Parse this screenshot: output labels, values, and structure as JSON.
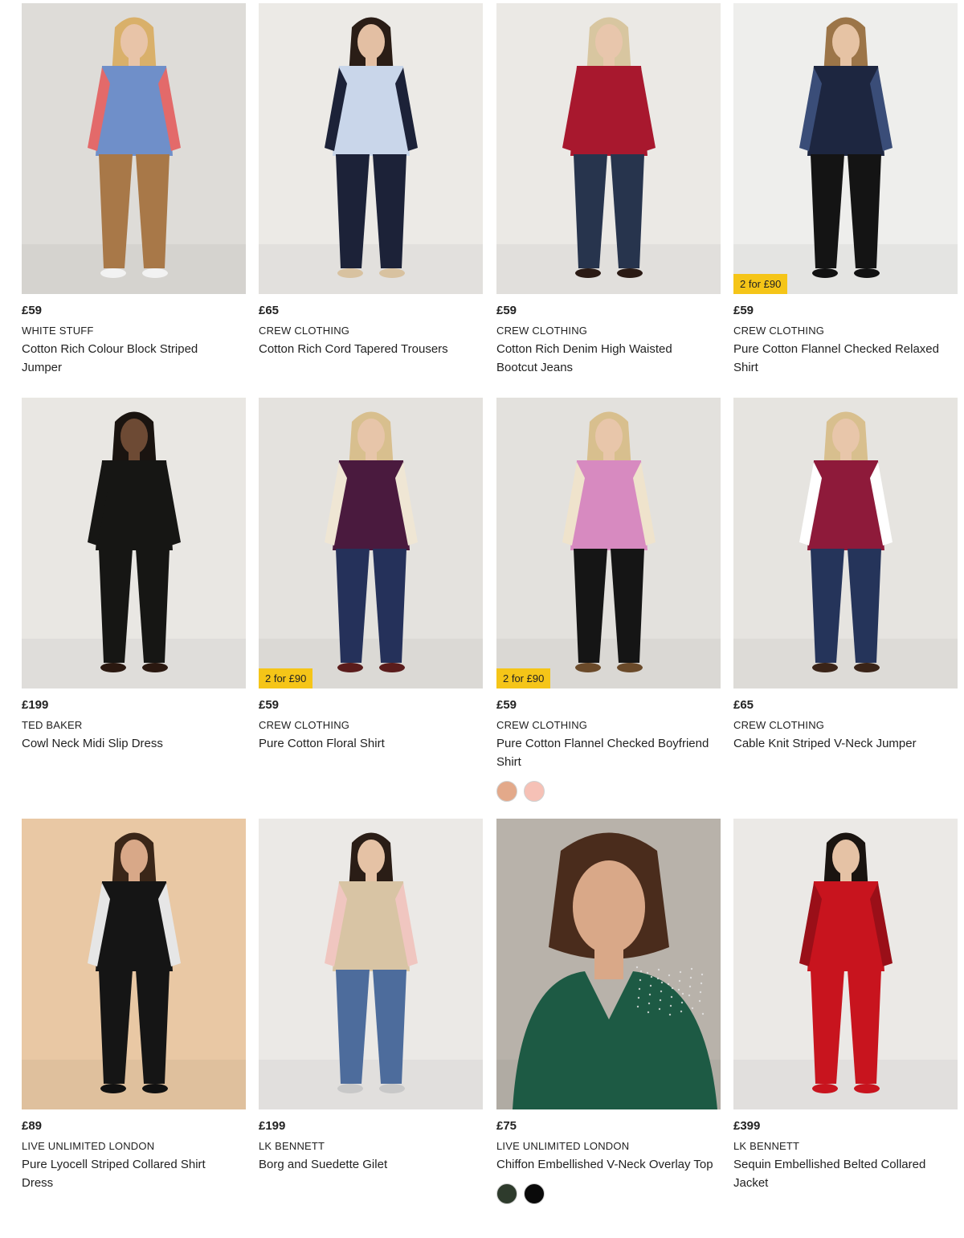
{
  "products": [
    {
      "price": "£59",
      "brand": "WHITE STUFF",
      "title": "Cotton Rich Colour Block Striped Jumper",
      "promo": "",
      "swatches": []
    },
    {
      "price": "£65",
      "brand": "CREW CLOTHING",
      "title": "Cotton Rich Cord Tapered Trousers",
      "promo": "",
      "swatches": []
    },
    {
      "price": "£59",
      "brand": "CREW CLOTHING",
      "title": "Cotton Rich Denim High Waisted Bootcut Jeans",
      "promo": "",
      "swatches": []
    },
    {
      "price": "£59",
      "brand": "CREW CLOTHING",
      "title": "Pure Cotton Flannel Checked Relaxed Shirt",
      "promo": "2 for £90",
      "swatches": []
    },
    {
      "price": "£199",
      "brand": "TED BAKER",
      "title": "Cowl Neck Midi Slip Dress",
      "promo": "",
      "swatches": []
    },
    {
      "price": "£59",
      "brand": "CREW CLOTHING",
      "title": "Pure Cotton Floral Shirt",
      "promo": "2 for £90",
      "swatches": []
    },
    {
      "price": "£59",
      "brand": "CREW CLOTHING",
      "title": "Pure Cotton Flannel Checked Boyfriend Shirt",
      "promo": "2 for £90",
      "swatches": [
        "#e3a98a",
        "#f6c1b6"
      ]
    },
    {
      "price": "£65",
      "brand": "CREW CLOTHING",
      "title": "Cable Knit Striped V-Neck Jumper",
      "promo": "",
      "swatches": []
    },
    {
      "price": "£89",
      "brand": "LIVE UNLIMITED LONDON",
      "title": "Pure Lyocell Striped Collared Shirt Dress",
      "promo": "",
      "swatches": []
    },
    {
      "price": "£199",
      "brand": "LK BENNETT",
      "title": "Borg and Suedette Gilet",
      "promo": "",
      "swatches": []
    },
    {
      "price": "£75",
      "brand": "LIVE UNLIMITED LONDON",
      "title": "Chiffon Embellished V-Neck Overlay Top",
      "promo": "",
      "swatches": [
        "#2e3b2c",
        "#0a0a0a"
      ]
    },
    {
      "price": "£399",
      "brand": "LK BENNETT",
      "title": "Sequin Embellished Belted Collared Jacket",
      "promo": "",
      "swatches": []
    }
  ],
  "images": [
    {
      "bg": "#dedcd8",
      "top": "#6f8fc9",
      "bottom": "#a87848",
      "accent": "#e36a6a",
      "hair": "#d9b06a",
      "skin": "#e8c4a8",
      "shoes": "#f2f2f2"
    },
    {
      "bg": "#eceae6",
      "top": "#c9d6ea",
      "bottom": "#1c2238",
      "accent": "#1c2238",
      "hair": "#2a1d16",
      "skin": "#e3bfa3",
      "shoes": "#d8c2a0"
    },
    {
      "bg": "#ebe9e5",
      "top": "#a8182e",
      "bottom": "#27344d",
      "accent": "#a8182e",
      "hair": "#d8c6a0",
      "skin": "#e8c6ac",
      "shoes": "#2a1a14"
    },
    {
      "bg": "#eeeeec",
      "top": "#1d2640",
      "bottom": "#141414",
      "accent": "#3a4d78",
      "hair": "#9c7548",
      "skin": "#e6c3a4",
      "shoes": "#111111"
    },
    {
      "bg": "#e9e7e3",
      "top": "#161614",
      "bottom": "#161614",
      "accent": "#161614",
      "hair": "#1a1410",
      "skin": "#6d4a34",
      "shoes": "#2a1810"
    },
    {
      "bg": "#e4e2de",
      "top": "#4a1a3e",
      "bottom": "#25315a",
      "accent": "#efe6d4",
      "hair": "#d8bf8e",
      "skin": "#e7c5a9",
      "shoes": "#5a1c1c"
    },
    {
      "bg": "#e3e1dd",
      "top": "#d78ac0",
      "bottom": "#151515",
      "accent": "#efe3cc",
      "hair": "#d8bf8e",
      "skin": "#e8c6aa",
      "shoes": "#6a4a2a"
    },
    {
      "bg": "#e6e4e0",
      "top": "#8e1a3a",
      "bottom": "#25345a",
      "accent": "#ffffff",
      "hair": "#d8bf8e",
      "skin": "#e8c6aa",
      "shoes": "#3a2418"
    },
    {
      "bg": "#e9c8a4",
      "top": "#151515",
      "bottom": "#151515",
      "accent": "#e6e6e6",
      "hair": "#3a2618",
      "skin": "#d8a888",
      "shoes": "#111111"
    },
    {
      "bg": "#ebe9e6",
      "top": "#d8c4a4",
      "bottom": "#4d6c9c",
      "accent": "#f0c6c0",
      "hair": "#2a1d16",
      "skin": "#e5c2a5",
      "shoes": "#c8c8c8"
    },
    {
      "bg": "#b8b2aa",
      "top": "#1d5a44",
      "bottom": "#1d5a44",
      "accent": "#1d5a44",
      "hair": "#4a2c1c",
      "skin": "#d9a888",
      "shoes": "#1d5a44"
    },
    {
      "bg": "#ebe9e6",
      "top": "#c8141e",
      "bottom": "#c8141e",
      "accent": "#9a0f18",
      "hair": "#1a1410",
      "skin": "#e5c2a5",
      "shoes": "#c8141e"
    }
  ]
}
